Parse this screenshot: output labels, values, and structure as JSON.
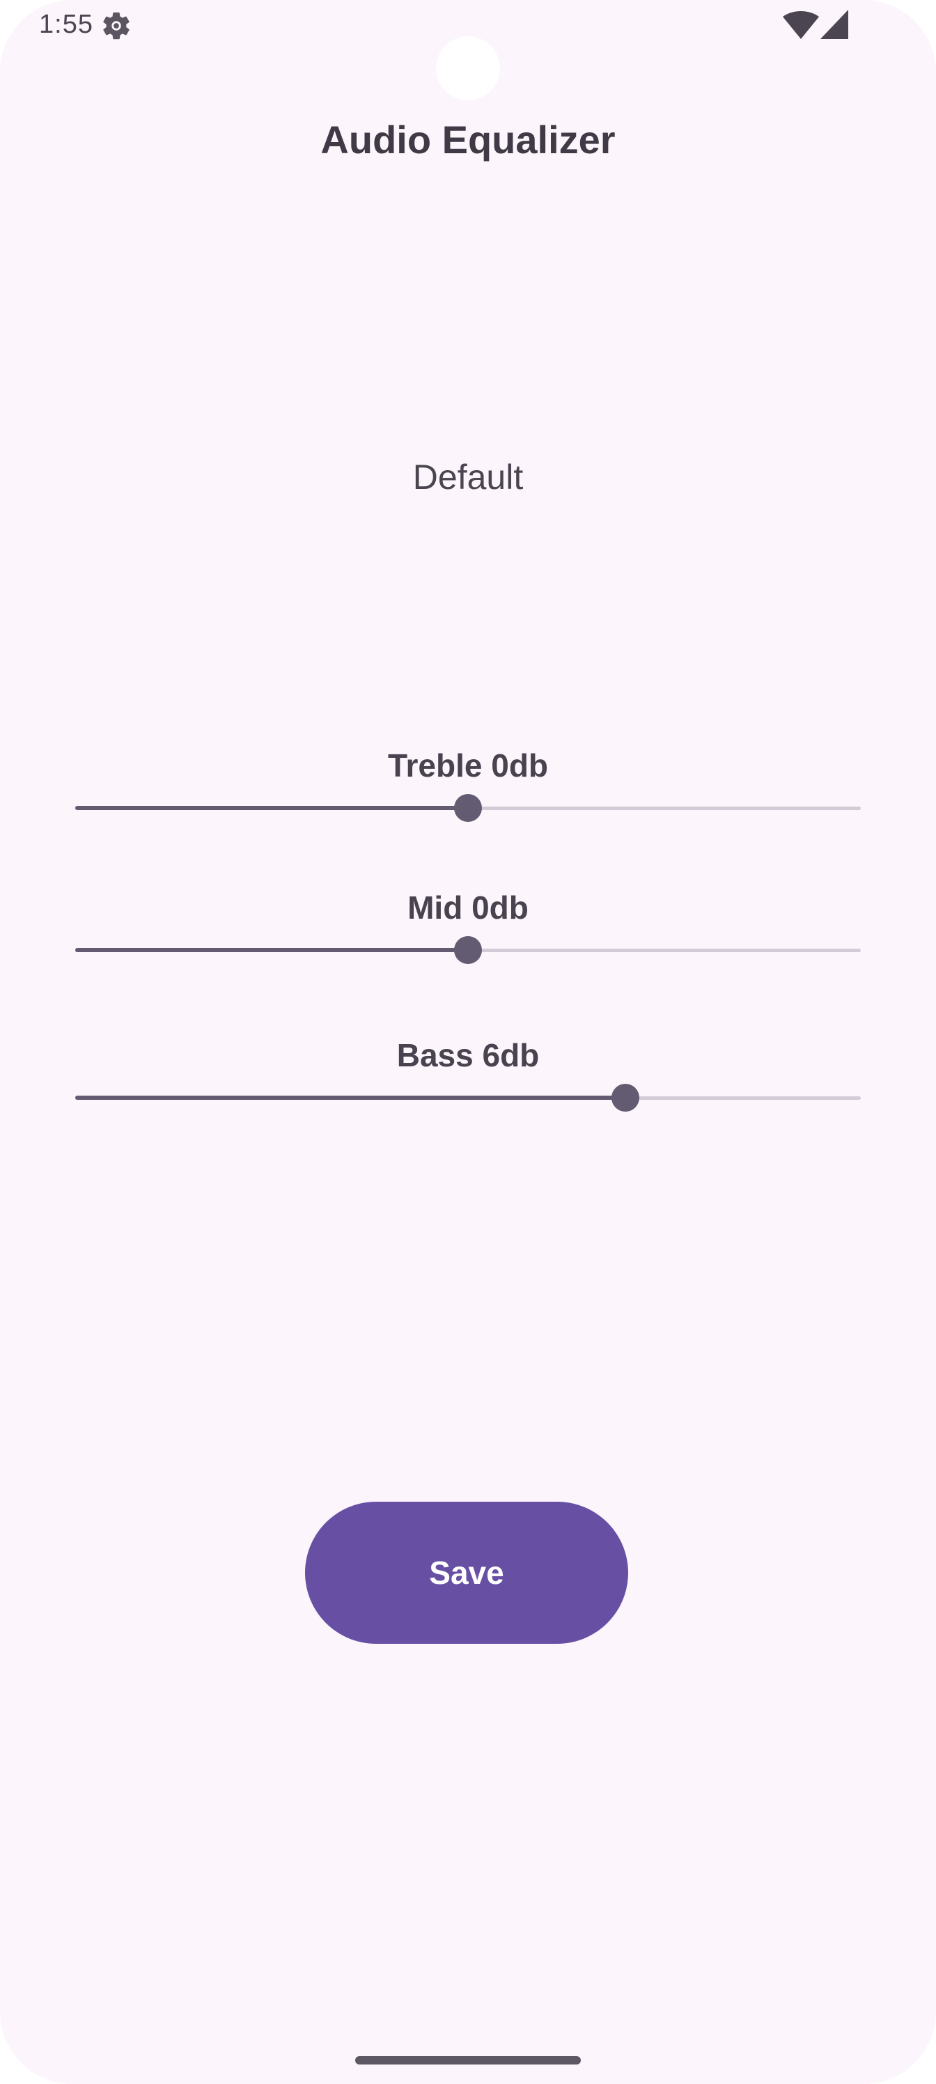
{
  "status_bar": {
    "time": "1:55",
    "icons": [
      "gear-icon",
      "wifi-icon",
      "signal-icon"
    ]
  },
  "header": {
    "title": "Audio Equalizer"
  },
  "preset": {
    "label": "Default"
  },
  "bands": [
    {
      "label": "Treble 0db",
      "value_db": 0,
      "fraction": 0.5
    },
    {
      "label": "Mid 0db",
      "value_db": 0,
      "fraction": 0.5
    },
    {
      "label": "Bass 6db",
      "value_db": 6,
      "fraction": 0.7
    }
  ],
  "actions": {
    "save_label": "Save"
  },
  "colors": {
    "background": "#fcf5fc",
    "accent": "#6750a4",
    "slider_active": "#625b71",
    "slider_inactive": "#d3ccd7",
    "text": "#3f3a45"
  }
}
